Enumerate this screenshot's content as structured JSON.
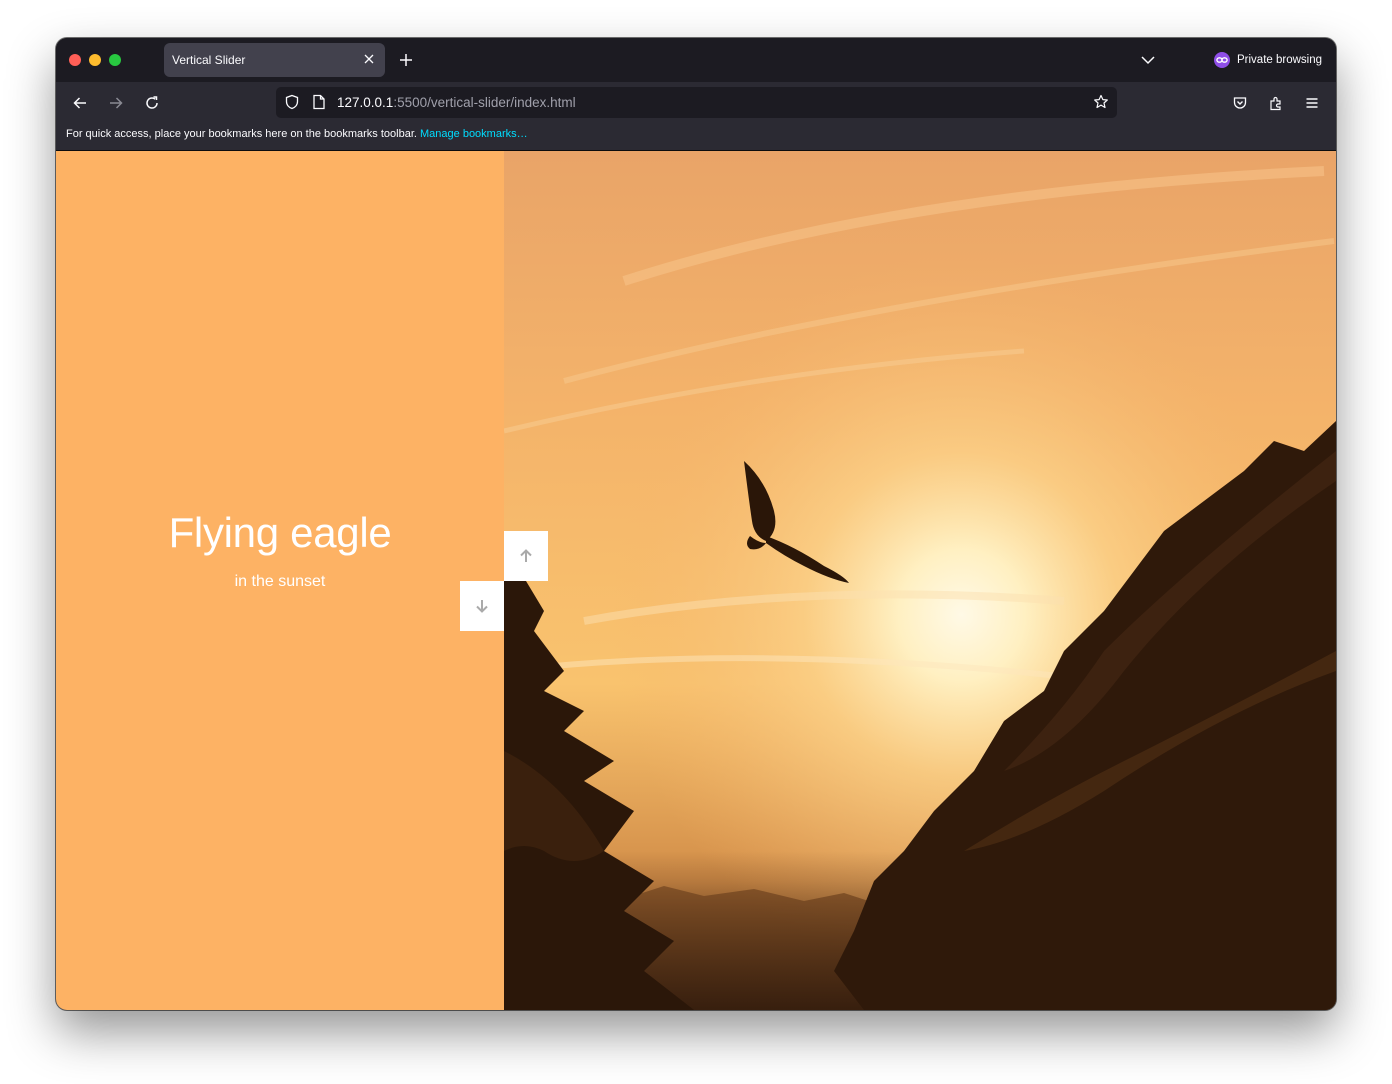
{
  "browser": {
    "tab_title": "Vertical Slider",
    "private_label": "Private browsing",
    "url_host": "127.0.0.1",
    "url_rest": ":5500/vertical-slider/index.html",
    "bookmarks_message": "For quick access, place your bookmarks here on the bookmarks toolbar.",
    "manage_bookmarks": "Manage bookmarks…"
  },
  "slide": {
    "title": "Flying eagle",
    "subtitle": "in the sunset",
    "background_color": "#fdb264"
  },
  "controls": {
    "up_icon": "arrow-up-icon",
    "down_icon": "arrow-down-icon"
  },
  "colors": {
    "accent_link": "#00ddff",
    "private_purple": "#8f4ee8"
  }
}
